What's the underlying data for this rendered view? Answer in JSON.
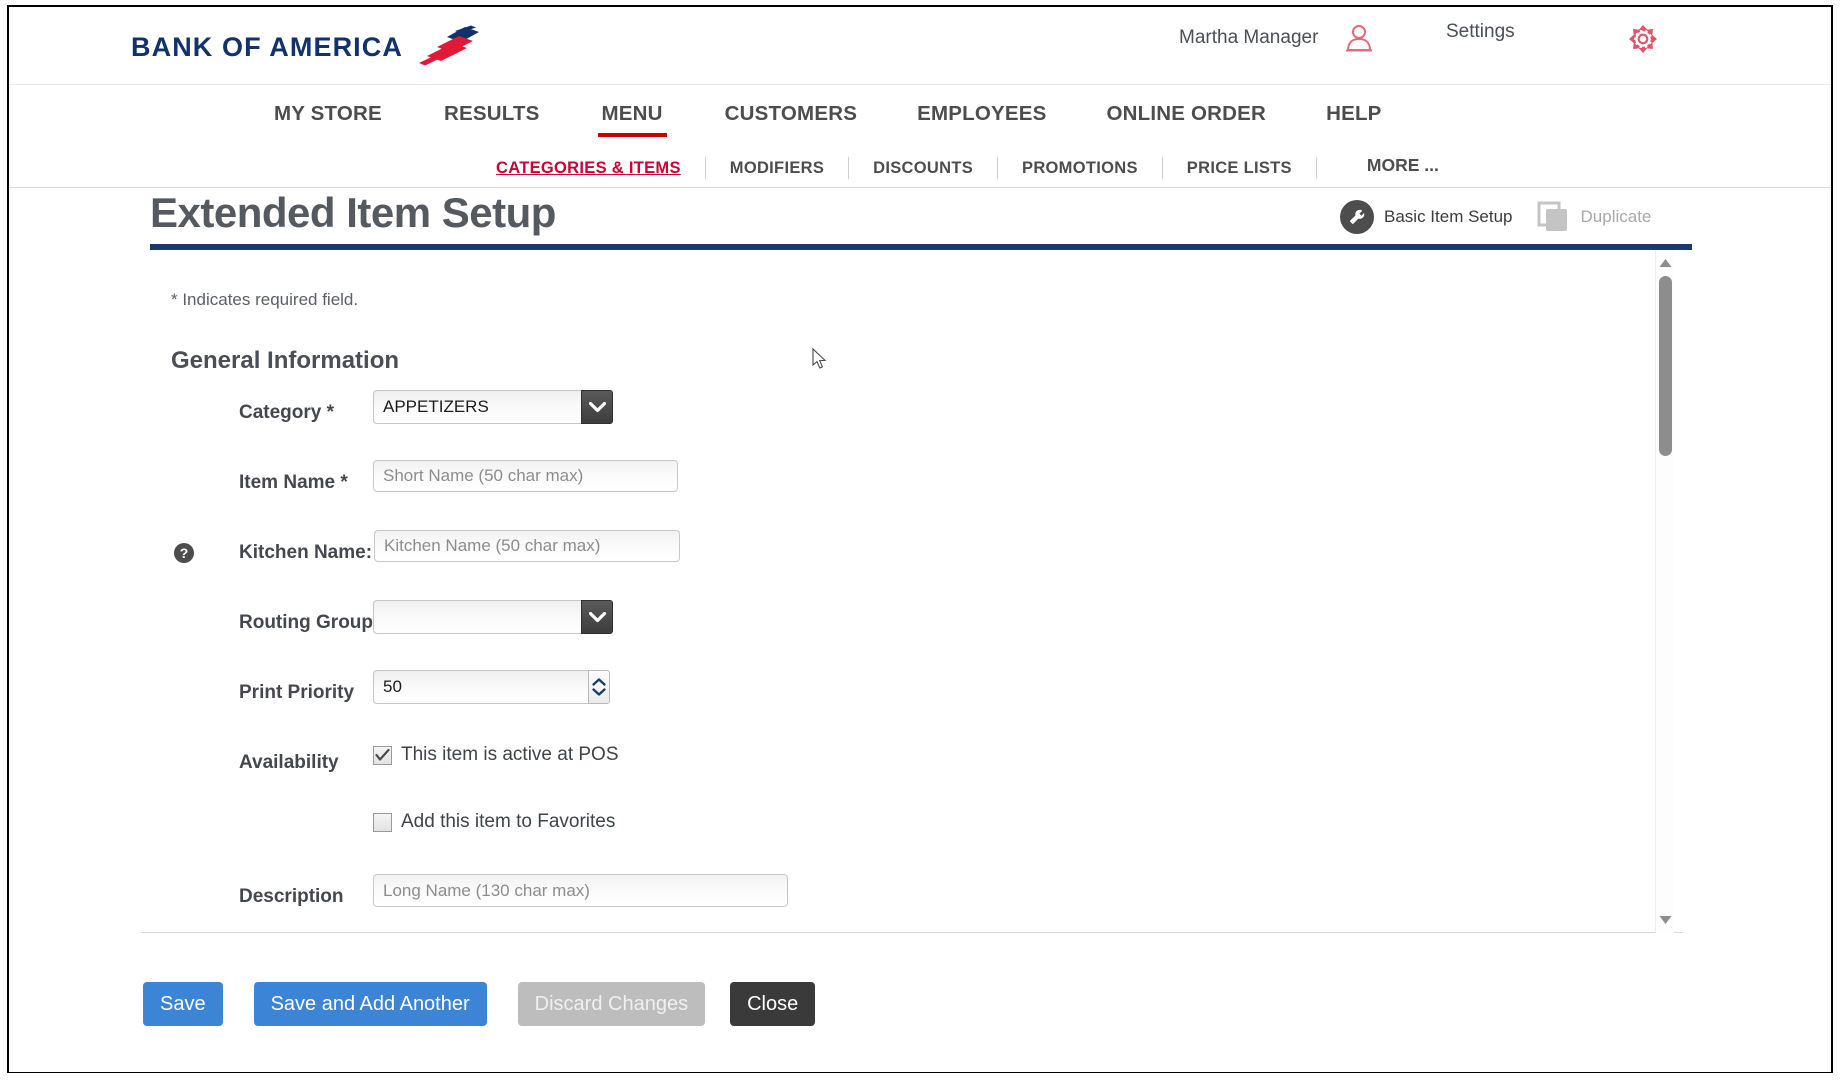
{
  "brand": {
    "name": "BANK OF AMERICA",
    "flag_colors": {
      "navy": "#12326b",
      "red": "#e31837"
    }
  },
  "header": {
    "user_name": "Martha Manager",
    "user_icon": "user-icon",
    "settings_label": "Settings",
    "gear_icon": "gear-icon"
  },
  "mainnav": {
    "items": [
      {
        "label": "MY STORE",
        "active": false
      },
      {
        "label": "RESULTS",
        "active": false
      },
      {
        "label": "MENU",
        "active": true
      },
      {
        "label": "CUSTOMERS",
        "active": false
      },
      {
        "label": "EMPLOYEES",
        "active": false
      },
      {
        "label": "ONLINE ORDER",
        "active": false
      },
      {
        "label": "HELP",
        "active": false
      }
    ],
    "active_accent": "#cc0000"
  },
  "subnav": {
    "items": [
      {
        "label": "CATEGORIES & ITEMS",
        "active": true
      },
      {
        "label": "MODIFIERS",
        "active": false
      },
      {
        "label": "DISCOUNTS",
        "active": false
      },
      {
        "label": "PROMOTIONS",
        "active": false
      },
      {
        "label": "PRICE LISTS",
        "active": false
      }
    ],
    "more_label": "MORE ...",
    "active_color": "#cc0033"
  },
  "page": {
    "title": "Extended Item Setup",
    "underline_color": "#1a3a6b",
    "actions": {
      "basic_item_setup": {
        "label": "Basic Item Setup",
        "icon": "wrench-icon",
        "disabled": false
      },
      "duplicate": {
        "label": "Duplicate",
        "icon": "duplicate-icon",
        "disabled": true
      }
    }
  },
  "form": {
    "required_note": "* Indicates required field.",
    "section_title": "General Information",
    "fields": {
      "category": {
        "label": "Category *",
        "value": "APPETIZERS",
        "options": [
          "APPETIZERS"
        ]
      },
      "item_name": {
        "label": "Item Name *",
        "value": "",
        "placeholder": "Short Name (50 char max)"
      },
      "kitchen_name": {
        "label": "Kitchen Name:",
        "value": "",
        "placeholder": "Kitchen Name (50 char max)",
        "help_icon": "help-icon"
      },
      "routing_group": {
        "label": "Routing Group",
        "value": "",
        "options": []
      },
      "print_priority": {
        "label": "Print Priority",
        "value": "50"
      },
      "availability": {
        "label": "Availability",
        "active_at_pos": {
          "label": "This item is active at POS",
          "checked": true
        },
        "add_to_favorites": {
          "label": "Add this item to Favorites",
          "checked": false
        }
      },
      "description": {
        "label": "Description",
        "value": "",
        "placeholder": "Long Name (130 char max)"
      }
    }
  },
  "footer": {
    "buttons": [
      {
        "label": "Save",
        "style": "blue"
      },
      {
        "label": "Save and Add Another",
        "style": "blue"
      },
      {
        "label": "Discard Changes",
        "style": "grey"
      },
      {
        "label": "Close",
        "style": "dark"
      }
    ]
  },
  "scrollbar": {
    "up_icon": "chevron-up-icon",
    "down_icon": "chevron-down-icon"
  }
}
